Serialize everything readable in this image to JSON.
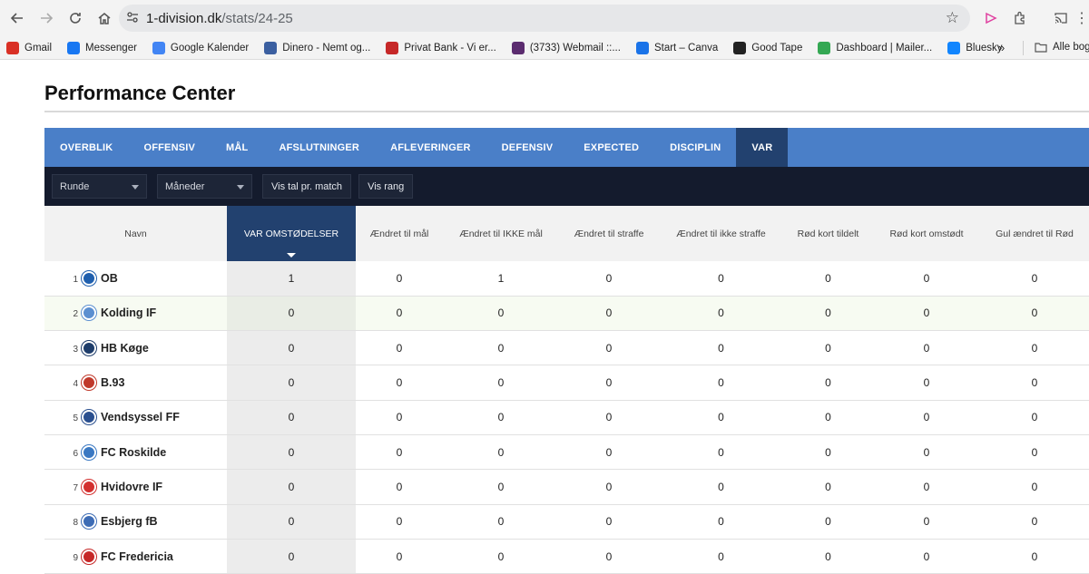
{
  "browser": {
    "url_host": "1-division.dk",
    "url_path": "/stats/24-25",
    "bookmarks": [
      {
        "label": "Gmail",
        "icon": "gmail-icon",
        "color": "#d93025"
      },
      {
        "label": "Messenger",
        "icon": "facebook-icon",
        "color": "#1877f2"
      },
      {
        "label": "Google Kalender",
        "icon": "calendar-icon",
        "color": "#4285f4"
      },
      {
        "label": "Dinero - Nemt og...",
        "icon": "dinero-icon",
        "color": "#3b5fa0"
      },
      {
        "label": "Privat Bank - Vi er...",
        "icon": "bank-icon",
        "color": "#c62828"
      },
      {
        "label": "(3733) Webmail ::...",
        "icon": "mail-icon",
        "color": "#5b2c6f"
      },
      {
        "label": "Start – Canva",
        "icon": "canva-icon",
        "color": "#1a73e8"
      },
      {
        "label": "Good Tape",
        "icon": "goodtape-icon",
        "color": "#222222"
      },
      {
        "label": "Dashboard | Mailer...",
        "icon": "mailer-icon",
        "color": "#34a853"
      },
      {
        "label": "Bluesky",
        "icon": "bluesky-icon",
        "color": "#1185fe"
      }
    ],
    "more_bookmarks_label": "»",
    "all_bookmarks_label": "Alle bog"
  },
  "page": {
    "title": "Performance Center"
  },
  "tabs": [
    {
      "label": "OVERBLIK",
      "active": false
    },
    {
      "label": "OFFENSIV",
      "active": false
    },
    {
      "label": "MÅL",
      "active": false
    },
    {
      "label": "AFSLUTNINGER",
      "active": false
    },
    {
      "label": "AFLEVERINGER",
      "active": false
    },
    {
      "label": "DEFENSIV",
      "active": false
    },
    {
      "label": "EXPECTED",
      "active": false
    },
    {
      "label": "DISCIPLIN",
      "active": false
    },
    {
      "label": "VAR",
      "active": true
    }
  ],
  "filters": {
    "round_select": "Runde",
    "months_select": "Måneder",
    "per_match_button": "Vis tal pr. match",
    "rank_button": "Vis rang"
  },
  "table": {
    "columns": [
      "Navn",
      "VAR OMSTØDELSER",
      "Ændret til mål",
      "Ændret til IKKE mål",
      "Ændret til straffe",
      "Ændret til ikke straffe",
      "Rød kort tildelt",
      "Rød kort omstødt",
      "Gul ændret til Rød"
    ],
    "rows": [
      {
        "rank": "1",
        "team": "OB",
        "crest_color": "#1f5fae",
        "values": [
          "1",
          "0",
          "1",
          "0",
          "0",
          "0",
          "0",
          "0"
        ]
      },
      {
        "rank": "2",
        "team": "Kolding IF",
        "crest_color": "#5b8fd0",
        "values": [
          "0",
          "0",
          "0",
          "0",
          "0",
          "0",
          "0",
          "0"
        ]
      },
      {
        "rank": "3",
        "team": "HB Køge",
        "crest_color": "#1e3d6b",
        "values": [
          "0",
          "0",
          "0",
          "0",
          "0",
          "0",
          "0",
          "0"
        ]
      },
      {
        "rank": "4",
        "team": "B.93",
        "crest_color": "#c0392b",
        "values": [
          "0",
          "0",
          "0",
          "0",
          "0",
          "0",
          "0",
          "0"
        ]
      },
      {
        "rank": "5",
        "team": "Vendsyssel FF",
        "crest_color": "#2a4f8f",
        "values": [
          "0",
          "0",
          "0",
          "0",
          "0",
          "0",
          "0",
          "0"
        ]
      },
      {
        "rank": "6",
        "team": "FC Roskilde",
        "crest_color": "#3a78c2",
        "values": [
          "0",
          "0",
          "0",
          "0",
          "0",
          "0",
          "0",
          "0"
        ]
      },
      {
        "rank": "7",
        "team": "Hvidovre IF",
        "crest_color": "#d3302f",
        "values": [
          "0",
          "0",
          "0",
          "0",
          "0",
          "0",
          "0",
          "0"
        ]
      },
      {
        "rank": "8",
        "team": "Esbjerg fB",
        "crest_color": "#3d6cb5",
        "values": [
          "0",
          "0",
          "0",
          "0",
          "0",
          "0",
          "0",
          "0"
        ]
      },
      {
        "rank": "9",
        "team": "FC Fredericia",
        "crest_color": "#c62828",
        "values": [
          "0",
          "0",
          "0",
          "0",
          "0",
          "0",
          "0",
          "0"
        ]
      }
    ]
  }
}
